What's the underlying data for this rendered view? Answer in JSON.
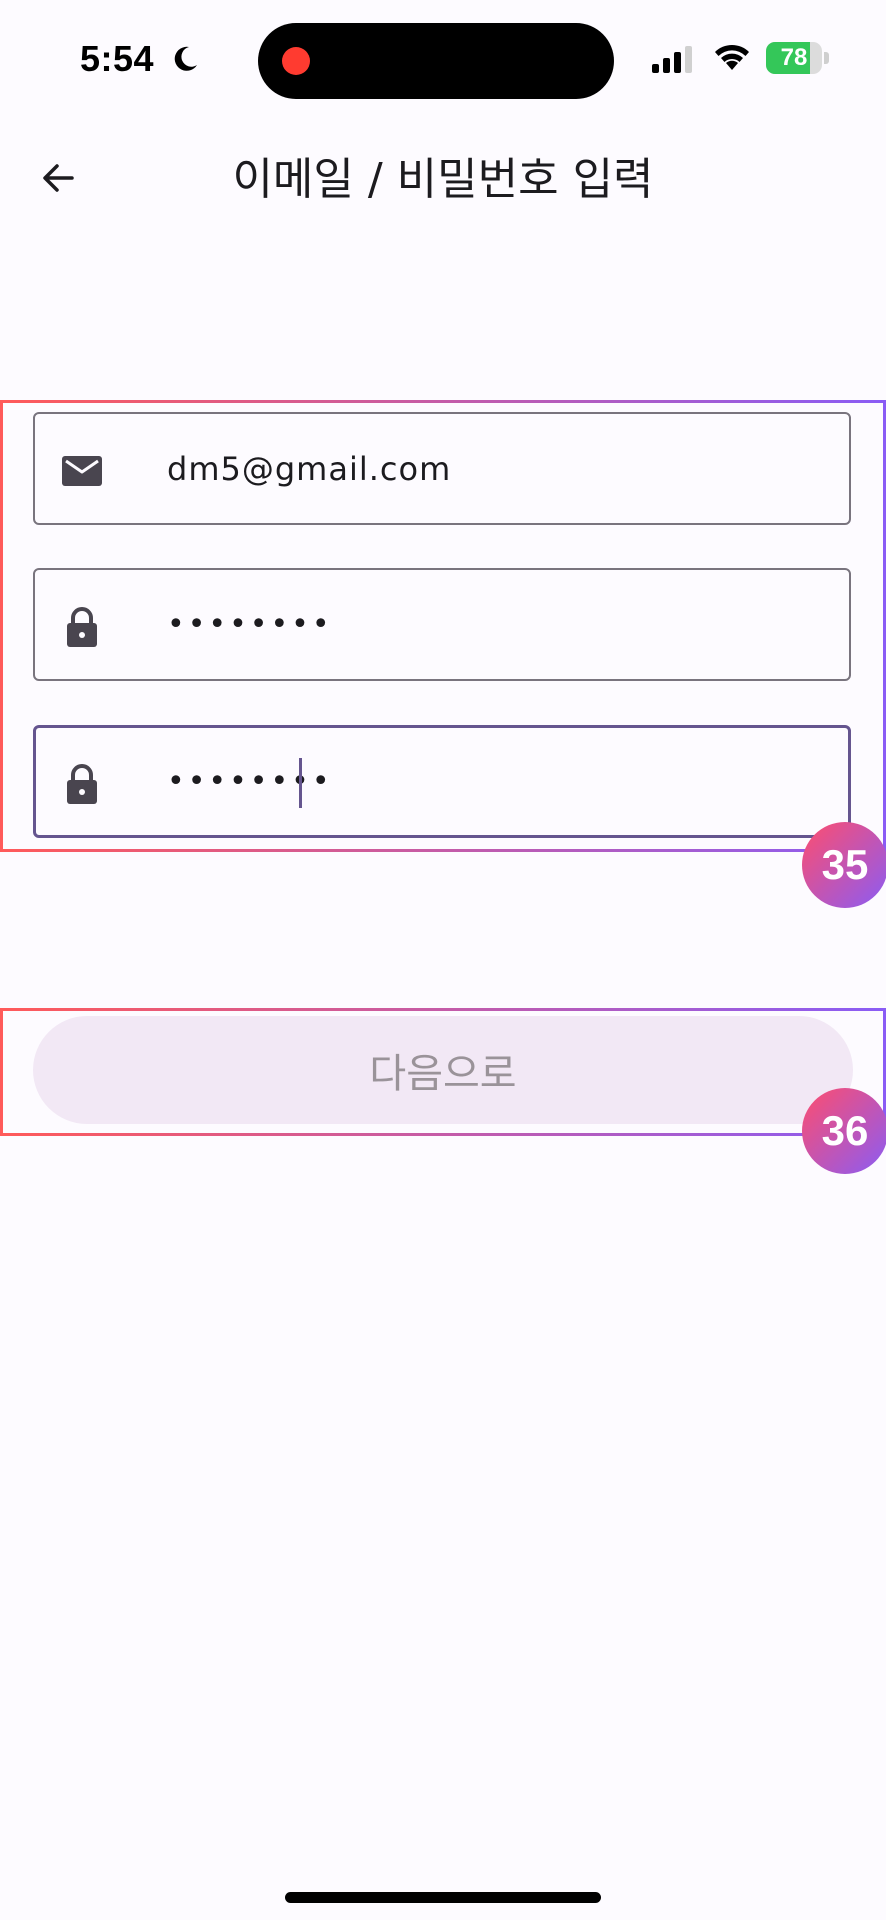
{
  "status_bar": {
    "time": "5:54",
    "battery_level": 78,
    "battery_text": "78",
    "battery_color": "#34c759",
    "record_dot_color": "#ff3b30",
    "icons": [
      "moon-icon",
      "signal-icon",
      "wifi-icon",
      "battery-icon"
    ]
  },
  "app_bar": {
    "back_icon": "arrow-left-icon",
    "title": "이메일 / 비밀번호 입력"
  },
  "form": {
    "email": {
      "icon": "mail-icon",
      "value": "dm5@gmail.com"
    },
    "password": {
      "icon": "lock-icon",
      "value": "••••••••"
    },
    "password_confirm": {
      "icon": "lock-icon",
      "value": "••••••••",
      "focused": true
    }
  },
  "next_button": {
    "label": "다음으로",
    "enabled": false
  },
  "overlays": [
    {
      "id": "35",
      "label": "35"
    },
    {
      "id": "36",
      "label": "36"
    }
  ],
  "colors": {
    "background": "#fdfbff",
    "focus_border": "#65558f",
    "outline": "#79747e",
    "button_disabled_bg": "#f2e8f5",
    "button_disabled_text": "#9a9399"
  }
}
